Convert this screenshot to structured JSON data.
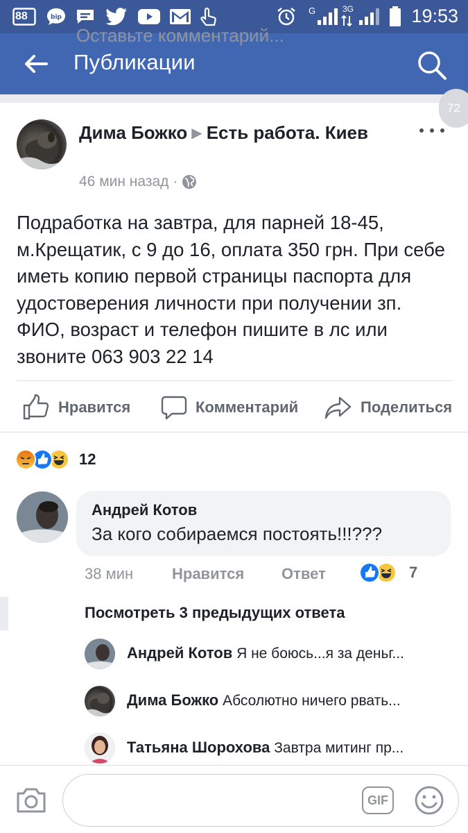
{
  "status_bar": {
    "notification_count": "88",
    "network_g": "G",
    "network_3g": "3G",
    "time": "19:53"
  },
  "header": {
    "title": "Публикации",
    "back_icon": "arrow-left-icon",
    "search_icon": "search-icon"
  },
  "scroll_counter": "72",
  "post": {
    "author": "Дима Божко",
    "group": "Есть работа. Киев",
    "time": "46 мин назад",
    "separator": "·",
    "privacy_icon": "globe-icon",
    "text": "Подработка на завтра, для парней 18-45, м.Крещатик, с 9 до 16, оплата 350 грн. При себе иметь копию первой страницы паспорта для удостоверения личности при получении зп. ФИО, возраст и телефон пишите в лс или звоните 063 903 22 14",
    "actions": {
      "like": "Нравится",
      "comment": "Комментарий",
      "share": "Поделиться"
    },
    "reactions": {
      "types": [
        "angry",
        "like",
        "haha"
      ],
      "count": "12"
    }
  },
  "comment": {
    "author": "Андрей Котов",
    "text": "За кого собираемся  постоять!!!???",
    "time": "38 мин",
    "like_label": "Нравится",
    "reply_label": "Ответ",
    "reaction_types": [
      "like",
      "haha"
    ],
    "reaction_count": "7",
    "view_previous": "Посмотреть 3 предыдущих ответа",
    "replies": [
      {
        "author": "Андрей Котов",
        "text": "Я не боюсь...я за деньг..."
      },
      {
        "author": "Дима Божко",
        "text": "Абсолютно ничего рвать..."
      },
      {
        "author": "Татьяна Шорохова",
        "text": "Завтра митинг пр..."
      }
    ]
  },
  "composer": {
    "placeholder": "Оставьте комментарий...",
    "gif_label": "GIF",
    "camera_icon": "camera-icon",
    "emoji_icon": "smiley-icon"
  },
  "colors": {
    "brand_blue": "#4267b2",
    "statusbar_blue": "#3b5998",
    "like_blue": "#1877f2",
    "reaction_yellow": "#f7c53f",
    "angry_red": "#e9710f"
  }
}
